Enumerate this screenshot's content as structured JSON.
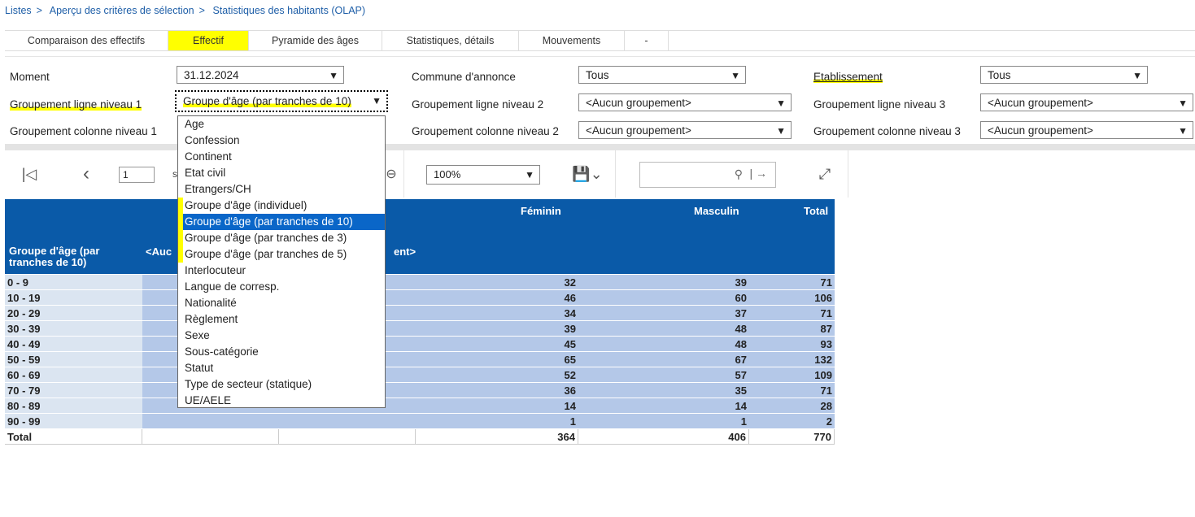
{
  "breadcrumb": [
    "Listes",
    "Aperçu des critères de sélection",
    "Statistiques des habitants (OLAP)"
  ],
  "breadcrumb_sep": ">",
  "tabs": [
    {
      "label": "Comparaison des effectifs",
      "active": false
    },
    {
      "label": "Effectif",
      "active": true
    },
    {
      "label": "Pyramide des âges",
      "active": false
    },
    {
      "label": "Statistiques, détails",
      "active": false
    },
    {
      "label": "Mouvements",
      "active": false
    },
    {
      "label": "-",
      "active": false
    }
  ],
  "filters": {
    "moment_label": "Moment",
    "moment_value": "31.12.2024",
    "commune_label": "Commune d'annonce",
    "commune_value": "Tous",
    "etab_label": "Etablissement",
    "etab_value": "Tous",
    "gl1_label": "Groupement ligne niveau 1",
    "gl1_value": "Groupe d'âge (par tranches de 10)",
    "gl2_label": "Groupement ligne niveau 2",
    "gl2_value": "<Aucun groupement>",
    "gl3_label": "Groupement ligne niveau 3",
    "gl3_value": "<Aucun groupement>",
    "gc1_label": "Groupement colonne niveau 1",
    "gc2_label": "Groupement colonne niveau 2",
    "gc2_value": "<Aucun groupement>",
    "gc3_label": "Groupement colonne niveau 3",
    "gc3_value": "<Aucun groupement>"
  },
  "toolbar": {
    "page_value": "1",
    "page_suffix": "s",
    "zoom_value": "100%",
    "search_placeholder": ""
  },
  "dropdown_options": [
    "Age",
    "Confession",
    "Continent",
    "Etat civil",
    "Etrangers/CH",
    "Groupe d'âge (individuel)",
    "Groupe d'âge (par tranches de 10)",
    "Groupe d'âge (par tranches de 3)",
    "Groupe d'âge (par tranches de 5)",
    "Interlocuteur",
    "Langue de corresp.",
    "Nationalité",
    "Règlement",
    "Sexe",
    "Sous-catégorie",
    "Statut",
    "Type de secteur  (statique)",
    "UE/AELE"
  ],
  "dropdown_selected": "Groupe d'âge (par tranches de 10)",
  "table": {
    "row_header": "Groupe d'âge (par tranches de 10)",
    "mid_header_left": "<Auc",
    "mid_header_right": "ent>",
    "col_feminin": "Féminin",
    "col_masculin": "Masculin",
    "col_total": "Total",
    "rows": [
      {
        "label": "0 - 9",
        "f": "32",
        "m": "39",
        "t": "71"
      },
      {
        "label": "10 - 19",
        "f": "46",
        "m": "60",
        "t": "106"
      },
      {
        "label": "20 - 29",
        "f": "34",
        "m": "37",
        "t": "71"
      },
      {
        "label": "30 - 39",
        "f": "39",
        "m": "48",
        "t": "87"
      },
      {
        "label": "40 - 49",
        "f": "45",
        "m": "48",
        "t": "93"
      },
      {
        "label": "50 - 59",
        "f": "65",
        "m": "67",
        "t": "132"
      },
      {
        "label": "60 - 69",
        "f": "52",
        "m": "57",
        "t": "109"
      },
      {
        "label": "70 - 79",
        "f": "36",
        "m": "35",
        "t": "71"
      },
      {
        "label": "80 - 89",
        "f": "14",
        "m": "14",
        "t": "28"
      },
      {
        "label": "90 - 99",
        "f": "1",
        "m": "1",
        "t": "2"
      }
    ],
    "total": {
      "label": "Total",
      "f": "364",
      "m": "406",
      "t": "770"
    }
  }
}
